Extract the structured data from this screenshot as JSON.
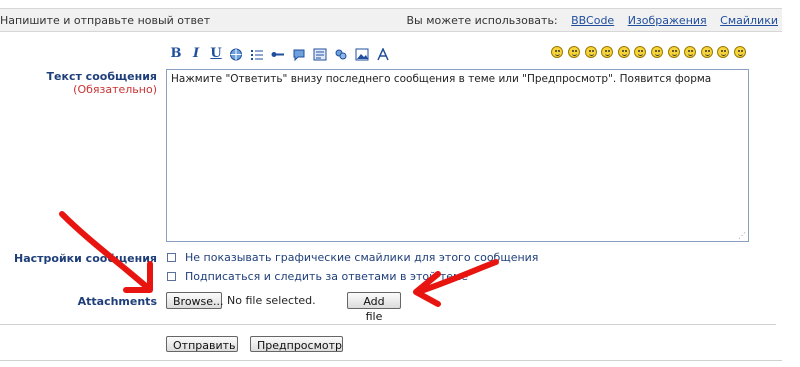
{
  "header": {
    "title": "Напишите и отправьте новый ответ",
    "hint": "Вы можете использовать:",
    "links": [
      "BBCode",
      "Изображения",
      "Смайлики"
    ]
  },
  "toolbar": {
    "buttons": [
      {
        "name": "bold-button",
        "icon": "bold-icon",
        "glyph": "B"
      },
      {
        "name": "italic-button",
        "icon": "italic-icon",
        "glyph": "I"
      },
      {
        "name": "underline-button",
        "icon": "underline-icon",
        "glyph": "U"
      },
      {
        "name": "link-button",
        "icon": "globe-link-icon"
      },
      {
        "name": "list-button",
        "icon": "list-icon"
      },
      {
        "name": "email-button",
        "icon": "email-icon"
      },
      {
        "name": "quote-button",
        "icon": "quote-icon"
      },
      {
        "name": "code-button",
        "icon": "code-icon"
      },
      {
        "name": "spoiler-button",
        "icon": "users-icon"
      },
      {
        "name": "image-button",
        "icon": "image-icon"
      },
      {
        "name": "font-button",
        "icon": "font-icon"
      }
    ],
    "smiley_count": 11
  },
  "form": {
    "message_label": "Текст сообщения",
    "required_label": "(Обязательно)",
    "message_value": "Нажмите \"Ответить\" внизу последнего сообщения в теме или \"Предпросмотр\". Появится форма",
    "options_label": "Настройки сообщения",
    "option_no_smilies": "Не показывать графические смайлики для этого сообщения",
    "option_subscribe": "Подписаться и следить за ответами в этой теме",
    "attachments_label": "Attachments",
    "browse_label": "Browse...",
    "no_file_text": "No file selected.",
    "add_file_label": "Add file"
  },
  "actions": {
    "submit_label": "Отправить",
    "preview_label": "Предпросмотр"
  },
  "annotations": {
    "arrow_color": "#e8140f"
  }
}
